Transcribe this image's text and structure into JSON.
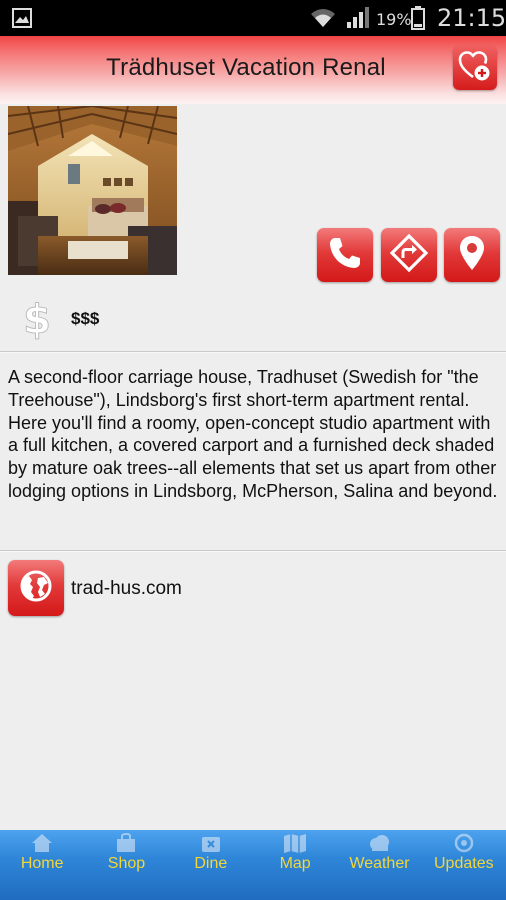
{
  "status_bar": {
    "battery_percent": "19%",
    "time": "21:15",
    "icons": [
      "image-icon",
      "wifi-icon",
      "signal-icon",
      "battery-icon"
    ]
  },
  "header": {
    "title": "Trädhuset Vacation Renal",
    "favorite_icon": "heart-plus-icon"
  },
  "listing": {
    "actions": [
      {
        "name": "call",
        "icon": "phone-icon"
      },
      {
        "name": "directions",
        "icon": "directions-icon"
      },
      {
        "name": "map",
        "icon": "map-pin-icon"
      }
    ],
    "price_icon": "dollar-icon",
    "price": "$$$",
    "description": "A second-floor carriage house, Tradhuset (Swedish for \"the Treehouse\"), Lindsborg's first short-term apartment rental. Here you'll find a roomy, open-concept studio apartment with a full kitchen, a covered carport and a furnished deck shaded by mature oak trees--all elements that set us apart from other lodging options in Lindsborg, McPherson, Salina and beyond.",
    "website_icon": "globe-icon",
    "website": "trad-hus.com"
  },
  "bottom_nav": {
    "items": [
      {
        "label": "Home",
        "icon": "home-icon"
      },
      {
        "label": "Shop",
        "icon": "shop-icon"
      },
      {
        "label": "Dine",
        "icon": "dine-icon"
      },
      {
        "label": "Map",
        "icon": "map-icon"
      },
      {
        "label": "Weather",
        "icon": "weather-icon"
      },
      {
        "label": "Updates",
        "icon": "updates-icon"
      }
    ]
  },
  "colors": {
    "accent_red": "#d41818",
    "nav_blue": "#2f86d8",
    "nav_label": "#f2d63a"
  }
}
